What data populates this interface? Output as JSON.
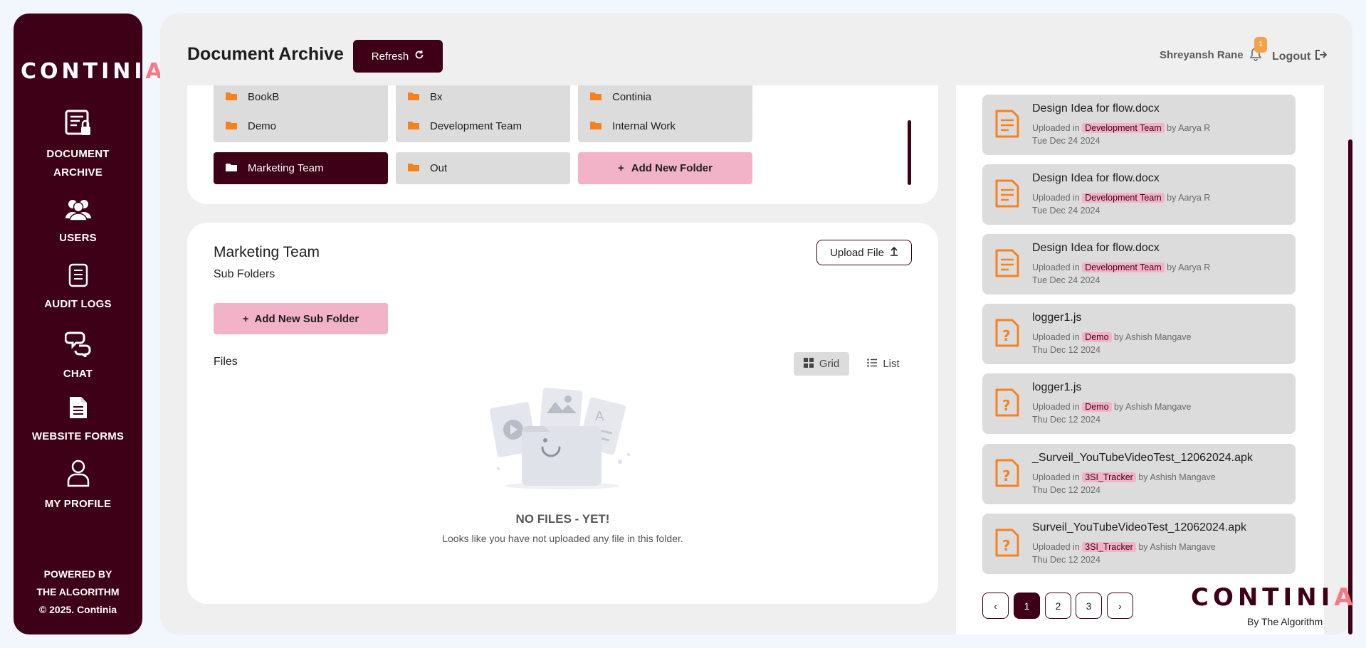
{
  "brand": {
    "logo_main": "CONTINI",
    "logo_accent": "A"
  },
  "sidebar": {
    "items": [
      {
        "label_1": "DOCUMENT",
        "label_2": "ARCHIVE"
      },
      {
        "label_1": "USERS"
      },
      {
        "label_1": "AUDIT LOGS"
      },
      {
        "label_1": "CHAT"
      },
      {
        "label_1": "WEBSITE FORMS"
      },
      {
        "label_1": "MY PROFILE"
      }
    ],
    "powered_1": "POWERED BY",
    "powered_2": "THE ALGORITHM",
    "powered_3": "© 2025. Continia"
  },
  "header": {
    "title": "Document Archive",
    "refresh_label": "Refresh",
    "user_name": "Shreyansh Rane",
    "notification_count": "1",
    "logout_label": "Logout"
  },
  "folders": {
    "row0": [
      "BookB",
      "Bx",
      "Continia"
    ],
    "row1": [
      "Demo",
      "Development Team",
      "Internal Work"
    ],
    "row2": [
      "Marketing Team",
      "Out"
    ],
    "add_label": "Add New Folder"
  },
  "subfolder": {
    "title": "Marketing Team",
    "sub_label": "Sub Folders",
    "upload_label": "Upload File",
    "add_sub_label": "Add New Sub Folder",
    "files_label": "Files",
    "grid_label": "Grid",
    "list_label": "List",
    "empty_title": "NO FILES - YET!",
    "empty_text": "Looks like you have not uploaded any file in this folder."
  },
  "recent": {
    "uploaded_in": "Uploaded in",
    "by": "by",
    "files": [
      {
        "name": "Design Idea for flow.docx",
        "folder": "Development Team",
        "user": "Aarya R",
        "date": "Tue Dec 24 2024",
        "icon": "document-icon"
      },
      {
        "name": "Design Idea for flow.docx",
        "folder": "Development Team",
        "user": "Aarya R",
        "date": "Tue Dec 24 2024",
        "icon": "document-icon"
      },
      {
        "name": "Design Idea for flow.docx",
        "folder": "Development Team",
        "user": "Aarya R",
        "date": "Tue Dec 24 2024",
        "icon": "document-icon"
      },
      {
        "name": "logger1.js",
        "folder": "Demo",
        "user": "Ashish Mangave",
        "date": "Thu Dec 12 2024",
        "icon": "unknown-file-icon"
      },
      {
        "name": "logger1.js",
        "folder": "Demo",
        "user": "Ashish Mangave",
        "date": "Thu Dec 12 2024",
        "icon": "unknown-file-icon"
      },
      {
        "name": "_Surveil_YouTubeVideoTest_12062024.apk",
        "folder": "3SI_Tracker",
        "user": "Ashish Mangave",
        "date": "Thu Dec 12 2024",
        "icon": "unknown-file-icon"
      },
      {
        "name": "Surveil_YouTubeVideoTest_12062024.apk",
        "folder": "3SI_Tracker",
        "user": "Ashish Mangave",
        "date": "Thu Dec 12 2024",
        "icon": "unknown-file-icon"
      }
    ]
  },
  "pagination": {
    "prev": "‹",
    "pages": [
      "1",
      "2",
      "3"
    ],
    "next": "›",
    "current": "1"
  },
  "footer_brand": {
    "by": "By The Algorithm"
  },
  "colors": {
    "primary": "#3d0016",
    "accent_pink": "#f2b3c9",
    "folder_orange": "#f5821f",
    "logo_accent": "#f47a84"
  }
}
